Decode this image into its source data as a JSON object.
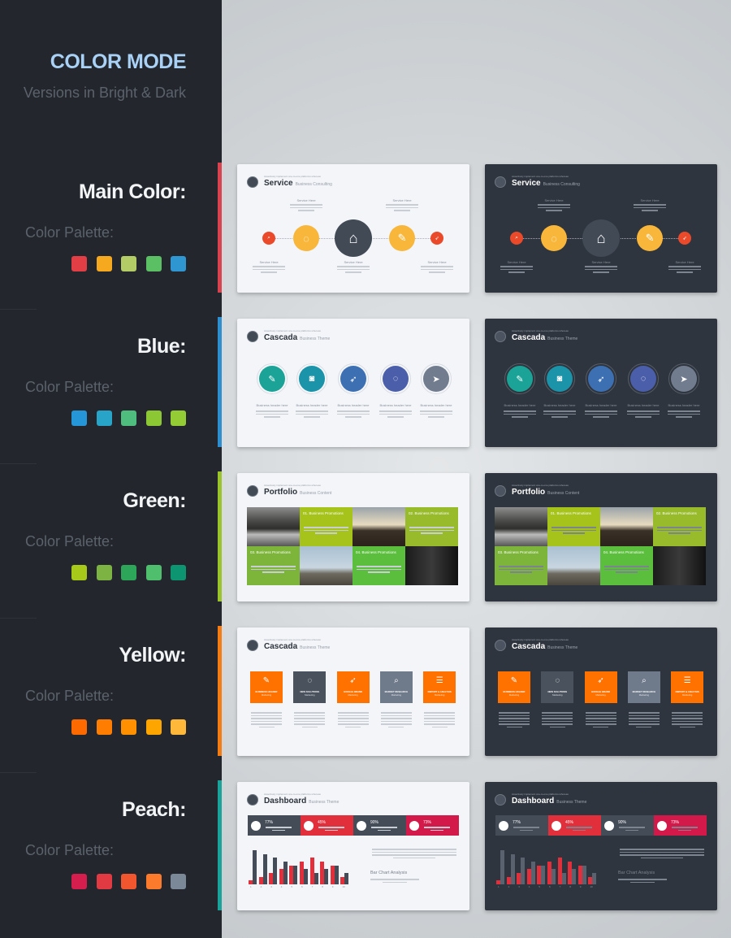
{
  "header": {
    "title": "COLOR MODE",
    "subtitle": "Versions in Bright & Dark"
  },
  "rows": [
    {
      "label": "Main Color:",
      "palette_label": "Color Palette:",
      "accent": "#d9434f",
      "palette": [
        "#e23e46",
        "#f6a81e",
        "#b4cc66",
        "#5bbf64",
        "#2f96d1"
      ],
      "slide": {
        "type": "service",
        "tagline": "Assertively implement one-to-one platforms whereas",
        "title": "Service",
        "subtitle": "Business Consulting",
        "items": [
          "Service Here",
          "Service Here",
          "Service Here",
          "Service Here",
          "Service Here"
        ],
        "colors": [
          "#ea4a2a",
          "#f8b63a",
          "#414a55",
          "#f8b63a",
          "#ea4a2a"
        ],
        "icons": [
          "search-icon",
          "lightbulb-icon",
          "graduation-cap-icon",
          "bandage-icon",
          "rocket-icon"
        ],
        "glyphs": [
          "⌕",
          "◌",
          "⌂",
          "✎",
          "➶"
        ]
      }
    },
    {
      "label": "Blue:",
      "palette_label": "Color Palette:",
      "accent": "#2d8fd0",
      "palette": [
        "#2597d9",
        "#27a4c8",
        "#4fbd7e",
        "#8bc833",
        "#94cc35"
      ],
      "slide": {
        "type": "circles",
        "tagline": "Assertively implement one-to-one platforms whereas",
        "title": "Cascada",
        "subtitle": "Business Theme",
        "items": [
          "Business header here",
          "Business header here",
          "Business header here",
          "Business header here",
          "Business header here"
        ],
        "colors": [
          "#1aa396",
          "#1b93a9",
          "#3c70b2",
          "#4b5ea9",
          "#717d8e"
        ],
        "icons": [
          "bandage-icon",
          "camera-icon",
          "rocket-icon",
          "lightbulb-icon",
          "paper-plane-icon"
        ],
        "glyphs": [
          "✎",
          "◙",
          "➶",
          "◌",
          "➤"
        ]
      }
    },
    {
      "label": "Green:",
      "palette_label": "Color Palette:",
      "accent": "#9ac42a",
      "palette": [
        "#a7c91a",
        "#7cb342",
        "#2ea65a",
        "#4fbf6e",
        "#0d9470"
      ],
      "slide": {
        "type": "portfolio",
        "tagline": "Assertively implement one-to-one platforms whereas",
        "title": "Portfolio",
        "subtitle": "Business Content",
        "cells": [
          {
            "kind": "photo",
            "photo": "lake-forest"
          },
          {
            "kind": "text",
            "heading": "01. Business Promotions",
            "color": "#a6c31b"
          },
          {
            "kind": "photo",
            "photo": "sunset-hills"
          },
          {
            "kind": "text",
            "heading": "02. Business Promotions",
            "color": "#97bb2a"
          },
          {
            "kind": "text",
            "heading": "03. Business Promotions",
            "color": "#7db53a"
          },
          {
            "kind": "photo",
            "photo": "person-on-rocks"
          },
          {
            "kind": "text",
            "heading": "04. Business Promotions",
            "color": "#5bbf3d"
          },
          {
            "kind": "photo",
            "photo": "wall-sign"
          }
        ]
      }
    },
    {
      "label": "Yellow:",
      "palette_label": "Color Palette:",
      "accent": "#f57c12",
      "palette": [
        "#ff6a00",
        "#ff7d00",
        "#ff9000",
        "#ffa500",
        "#ffb83a"
      ],
      "slide": {
        "type": "boxes",
        "tagline": "Assertively implement one-to-one platforms whereas",
        "title": "Cascada",
        "subtitle": "Business Theme",
        "items": [
          {
            "name": "BUSINESS HOLDER",
            "sub": "Marketing",
            "color": "#ff7200",
            "icon": "bandage-icon",
            "glyph": "✎"
          },
          {
            "name": "NEW SOLUTIONS",
            "sub": "Marketing",
            "color": "#4a525d",
            "icon": "lightbulb-icon",
            "glyph": "◌"
          },
          {
            "name": "GOOGLE BRAND",
            "sub": "Marketing",
            "color": "#ff7200",
            "icon": "rocket-icon",
            "glyph": "➶"
          },
          {
            "name": "MARKET RESEARCH",
            "sub": "Marketing",
            "color": "#6f7a8b",
            "icon": "search-icon",
            "glyph": "⌕"
          },
          {
            "name": "REPORT & ANALYSIS",
            "sub": "Marketing",
            "color": "#ff7200",
            "icon": "people-icon",
            "glyph": "☰"
          }
        ]
      }
    },
    {
      "label": "Peach:",
      "palette_label": "Color Palette:",
      "accent": "#1aa39a",
      "palette": [
        "#d61e4e",
        "#e23a42",
        "#f2562f",
        "#fb7a2c",
        "#7a8898"
      ],
      "slide": {
        "type": "dashboard",
        "tagline": "Assertively implement one-to-one platforms whereas",
        "title": "Dashboard",
        "subtitle": "Business Theme",
        "cards": [
          {
            "value": "77%",
            "color": "#444c57",
            "icon": "printer-icon"
          },
          {
            "value": "45%",
            "color": "#e1303b",
            "icon": "camera-icon"
          },
          {
            "value": "90%",
            "color": "#444c57",
            "icon": "briefcase-icon"
          },
          {
            "value": "73%",
            "color": "#d3184a",
            "icon": "camera-icon"
          }
        ],
        "analysis_title": "Bar Chart Analysis",
        "chart_data": {
          "type": "bar",
          "categories": [
            "1",
            "2",
            "3",
            "4",
            "5",
            "6",
            "7",
            "8",
            "9",
            "10"
          ],
          "series": [
            {
              "color": "#e1303b",
              "values": [
                1,
                2,
                3,
                4,
                5,
                6,
                7,
                6,
                5,
                2
              ]
            },
            {
              "color": "#444c57",
              "values": [
                9,
                8,
                7,
                6,
                5,
                4,
                3,
                4,
                5,
                3
              ]
            }
          ],
          "ylim": [
            0,
            9
          ]
        }
      }
    }
  ]
}
